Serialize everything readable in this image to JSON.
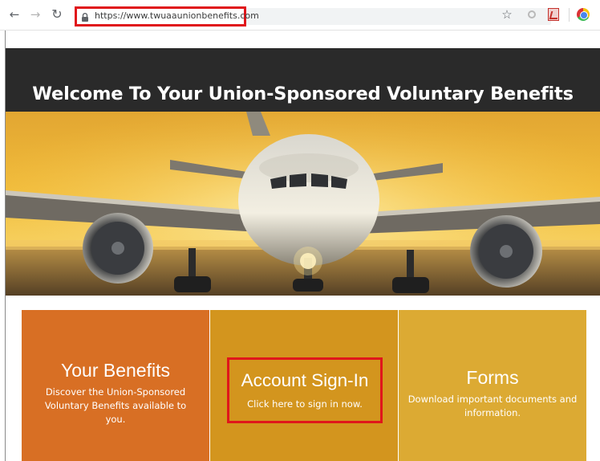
{
  "browser": {
    "back_icon": "arrow-left-icon",
    "forward_icon": "arrow-right-icon",
    "reload_icon": "reload-icon",
    "url": "https://www.twuaaunionbenefits.com",
    "highlight_color": "#e0161b",
    "bookmark_icon": "star-icon"
  },
  "hero": {
    "title": "Welcome To Your Union-Sponsored Voluntary Benefits",
    "image": "airplane-on-runway-at-sunset"
  },
  "cards": [
    {
      "title": "Your Benefits",
      "description": "Discover the Union-Sponsored Voluntary Benefits available to you.",
      "color": "#d86f24"
    },
    {
      "title": "Account Sign-In",
      "description": "Click here to sign in now.",
      "color": "#d3951e"
    },
    {
      "title": "Forms",
      "description": "Download important documents and information.",
      "color": "#dcaa33"
    }
  ]
}
